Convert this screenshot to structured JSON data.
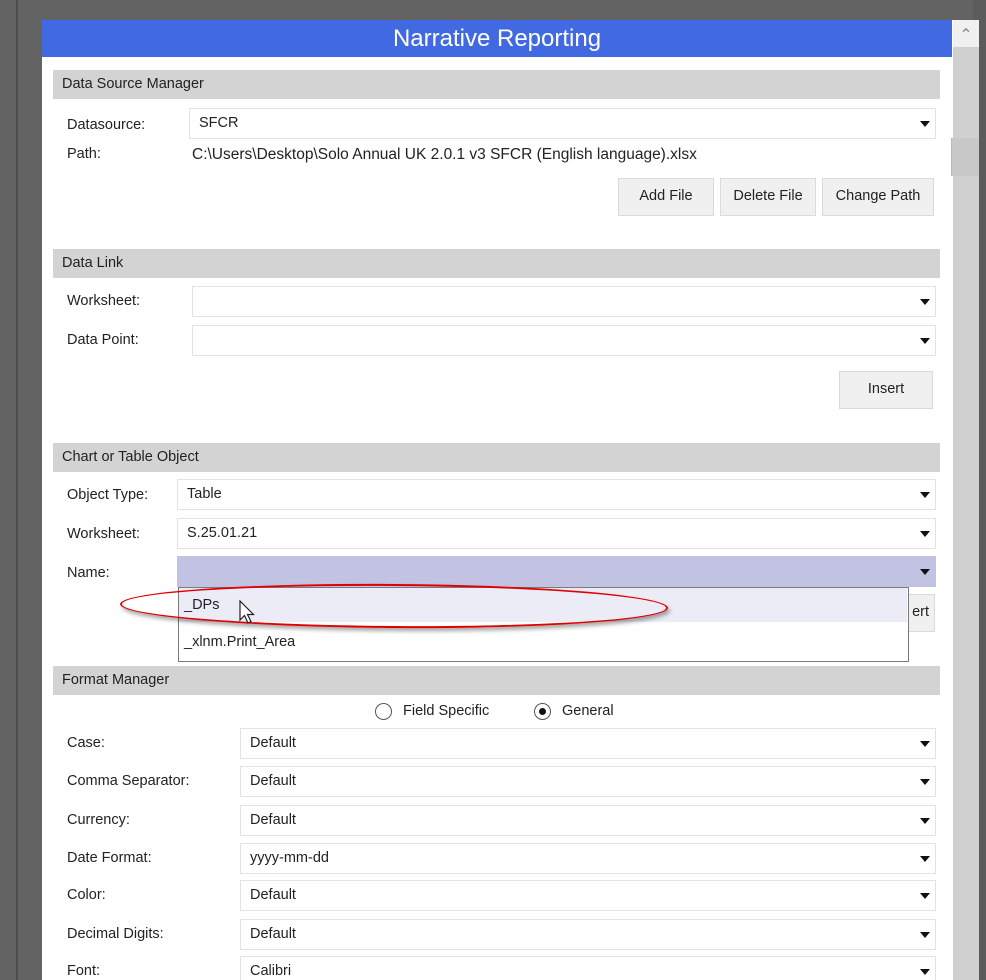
{
  "app": {
    "title": "Narrative Reporting"
  },
  "data_source_manager": {
    "heading": "Data Source Manager",
    "datasource_label": "Datasource:",
    "datasource_value": "SFCR",
    "path_label": "Path:",
    "path_value": "C:\\Users\\Desktop\\Solo Annual UK 2.0.1 v3 SFCR (English language).xlsx",
    "buttons": {
      "add_file": "Add File",
      "delete_file": "Delete File",
      "change_path": "Change Path"
    }
  },
  "data_link": {
    "heading": "Data Link",
    "worksheet_label": "Worksheet:",
    "worksheet_value": "",
    "data_point_label": "Data Point:",
    "data_point_value": "",
    "insert_label": "Insert"
  },
  "chart_table_object": {
    "heading": "Chart or Table Object",
    "object_type_label": "Object Type:",
    "object_type_value": "Table",
    "worksheet_label": "Worksheet:",
    "worksheet_value": "S.25.01.21",
    "name_label": "Name:",
    "name_value": "",
    "insert_label_partial": "ert",
    "name_options": [
      "_DPs",
      "_xlnm.Print_Area"
    ],
    "highlighted_option": "_DPs"
  },
  "format_manager": {
    "heading": "Format Manager",
    "mode_options": [
      {
        "label": "Field Specific",
        "checked": false
      },
      {
        "label": "General",
        "checked": true
      }
    ],
    "fields": [
      {
        "label": "Case:",
        "value": "Default"
      },
      {
        "label": "Comma Separator:",
        "value": "Default"
      },
      {
        "label": "Currency:",
        "value": "Default"
      },
      {
        "label": "Date Format:",
        "value": "yyyy-mm-dd"
      },
      {
        "label": "Color:",
        "value": "Default"
      },
      {
        "label": "Decimal Digits:",
        "value": "Default"
      },
      {
        "label": "Font:",
        "value": "Calibri"
      }
    ]
  },
  "annotation": {
    "color": "#e00000",
    "target": "_DPs"
  },
  "colors": {
    "titlebar": "#4169e1",
    "section_header": "#d3d3d3",
    "active_combo": "#c2c2e3"
  }
}
